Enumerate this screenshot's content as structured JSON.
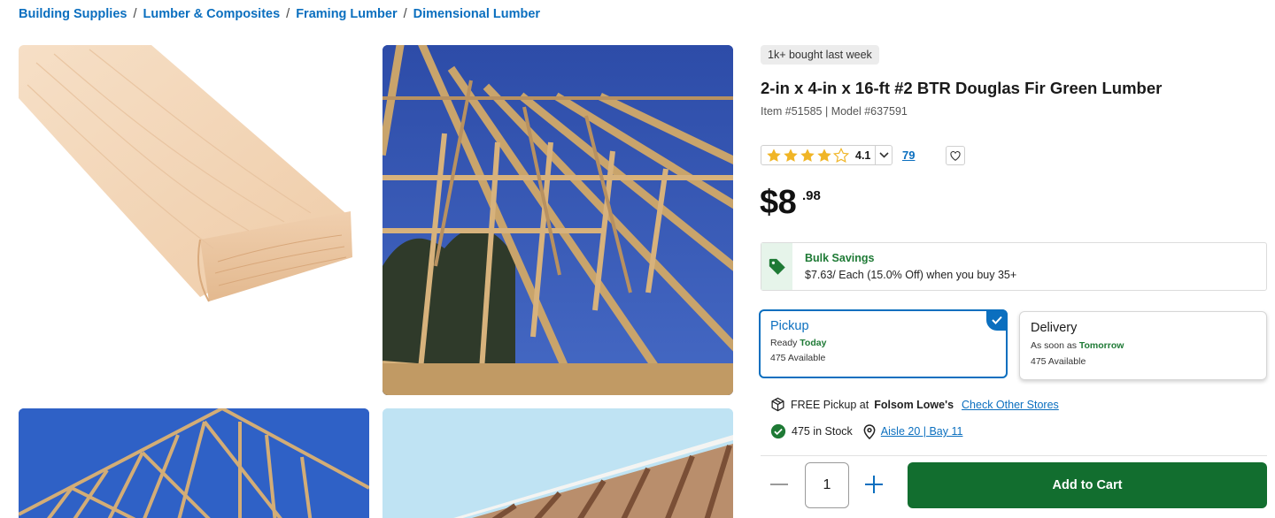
{
  "breadcrumb": [
    "Building Supplies",
    "Lumber & Composites",
    "Framing Lumber",
    "Dimensional Lumber"
  ],
  "product": {
    "badge": "1k+ bought last week",
    "title": "2-in x 4-in x 16-ft #2 BTR Douglas Fir Green Lumber",
    "ids": "Item #51585 | Model #637591",
    "rating": "4.1",
    "rating_value": 4.1,
    "reviews": "79",
    "price_dollars": "$8",
    "price_cents": ".98"
  },
  "bulk": {
    "title": "Bulk Savings",
    "text": "$7.63/ Each (15.0% Off) when you buy 35+"
  },
  "fulfillment": {
    "pickup": {
      "title": "Pickup",
      "ready_prefix": "Ready",
      "ready_when": "Today",
      "available": "475 Available",
      "selected": true
    },
    "delivery": {
      "title": "Delivery",
      "ready_prefix": "As soon as",
      "ready_when": "Tomorrow",
      "available": "475 Available",
      "selected": false
    }
  },
  "store": {
    "free_pickup_text": "FREE Pickup at",
    "store_name": "Folsom Lowe's",
    "check_other": "Check Other Stores",
    "stock": "475 in Stock",
    "aisle": "Aisle 20 | Bay 11"
  },
  "cart": {
    "quantity": "1",
    "add_label": "Add to Cart"
  },
  "colors": {
    "link_blue": "#0b6fbf",
    "cart_green": "#126e2f",
    "star_gold": "#f0b526"
  },
  "icons": [
    "heart-icon",
    "tag-icon",
    "package-icon",
    "check-circle-icon",
    "location-pin-icon",
    "minus-icon",
    "plus-icon",
    "chevron-down-icon",
    "checkmark-icon"
  ]
}
